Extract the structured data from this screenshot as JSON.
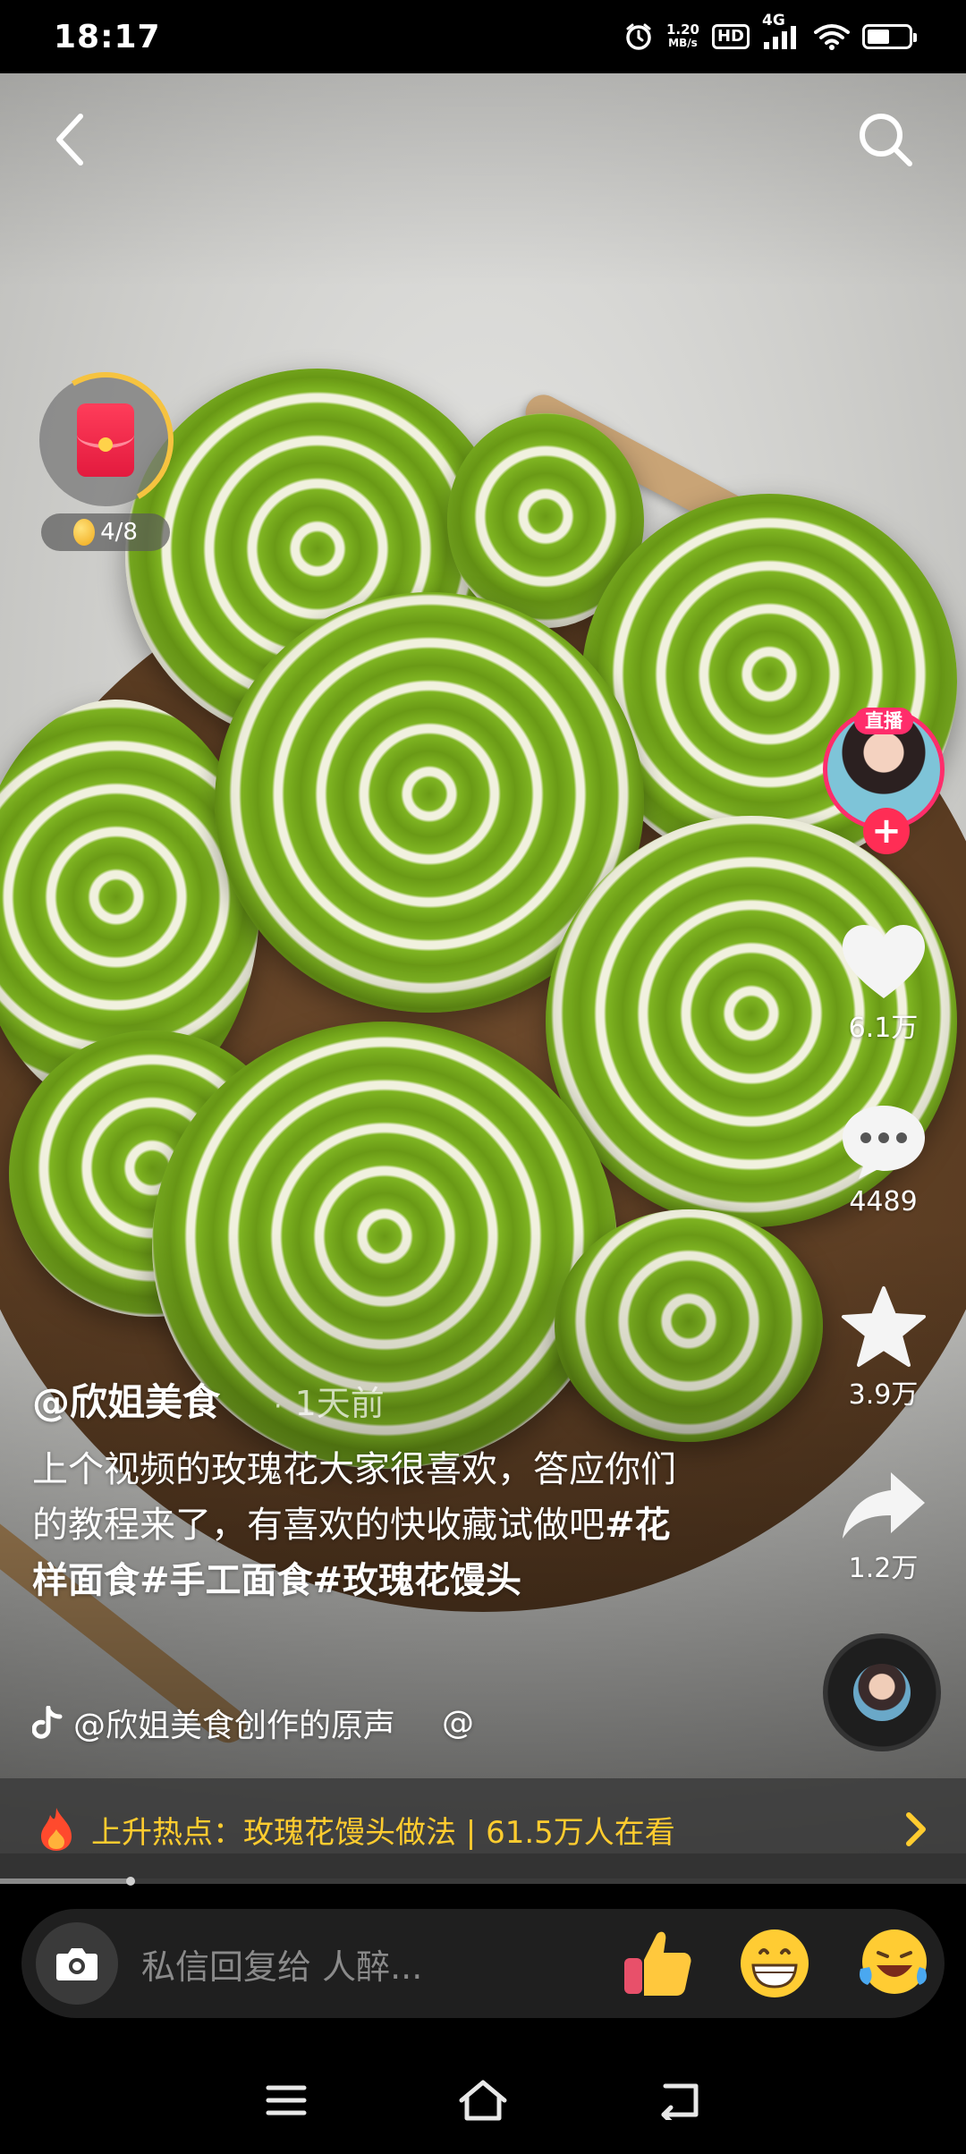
{
  "status_bar": {
    "time": "18:17",
    "net_speed_value": "1.20",
    "net_speed_unit": "MB/s",
    "hd": "HD",
    "network": "4G",
    "battery_level": 0.55
  },
  "video": {
    "red_packet": {
      "progress": "4/8"
    },
    "author": "@欣姐美食",
    "separator": "·",
    "post_time": "1天前",
    "caption_text": "上个视频的玫瑰花大家很喜欢，答应你们的教程来了，有喜欢的快收藏试做吧",
    "hashtags": [
      "#花样面食",
      "#手工面食",
      "#玫瑰花馒头"
    ],
    "sound": "@欣姐美食创作的原声",
    "sound_mention": "@"
  },
  "actions": {
    "live_badge": "直播",
    "follow_label": "+",
    "likes": "6.1万",
    "comments": "4489",
    "favorites": "3.9万",
    "shares": "1.2万"
  },
  "hotspot": {
    "text": "上升热点：玫瑰花馒头做法 | 61.5万人在看",
    "accent_color": "#ffcc2f"
  },
  "progress": {
    "played_fraction": 0.135
  },
  "input_bar": {
    "placeholder": "私信回复给 人醉..."
  },
  "icons": {
    "back": "chevron-left-icon",
    "search": "search-icon",
    "like": "heart-icon",
    "comment": "comment-bubble-icon",
    "favorite": "star-icon",
    "share": "share-arrow-icon",
    "camera": "camera-icon",
    "emoji_1": "thumbs-up-emoji",
    "emoji_2": "grin-emoji",
    "emoji_3": "laughing-tears-emoji",
    "nav_menu": "menu-icon",
    "nav_home": "home-icon",
    "nav_back": "back-icon"
  },
  "colors": {
    "live_pink": "#ff2d6b",
    "hotspot_text": "#ffcc2f"
  }
}
